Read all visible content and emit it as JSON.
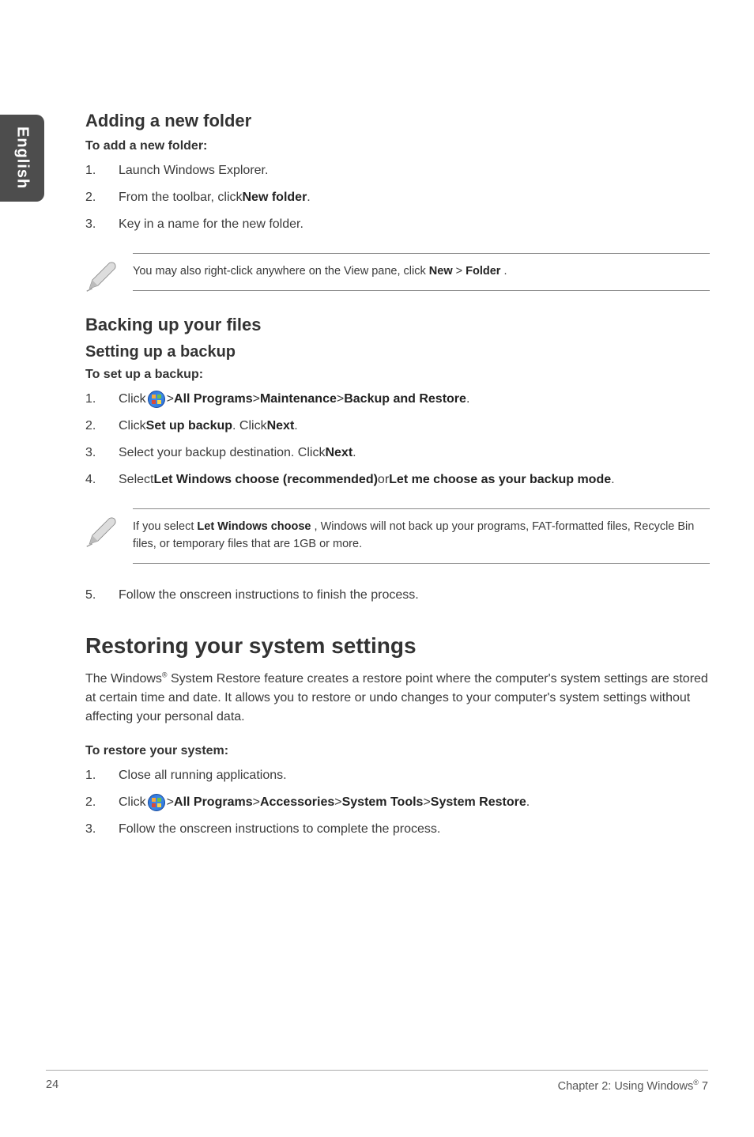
{
  "sideTab": "English",
  "sections": {
    "addFolder": {
      "heading": "Adding a new folder",
      "sub": "To add a new folder:",
      "steps": {
        "n1": "1.",
        "t1": "Launch Windows Explorer.",
        "n2": "2.",
        "t2a": "From the toolbar, click ",
        "t2b": "New folder",
        "t2c": ".",
        "n3": "3.",
        "t3": "Key in a name for the new folder."
      },
      "noteA": "You may also right-click anywhere on the View pane, click ",
      "noteB": "New",
      "noteC": " > ",
      "noteD": "Folder",
      "noteE": "."
    },
    "backup": {
      "heading": "Backing up your files",
      "subA": "Setting up a backup",
      "subB": "To set up a backup:",
      "steps": {
        "n1": "1.",
        "t1a": "Click ",
        "t1b": " > ",
        "t1c": "All Programs",
        "t1d": " > ",
        "t1e": "Maintenance",
        "t1f": " > ",
        "t1g": "Backup and Restore",
        "t1h": ".",
        "n2": "2.",
        "t2a": "Click ",
        "t2b": "Set up backup",
        "t2c": ". Click ",
        "t2d": "Next",
        "t2e": ".",
        "n3": "3.",
        "t3a": "Select your backup destination. Click ",
        "t3b": "Next",
        "t3c": ".",
        "n4": "4.",
        "t4a": "Select ",
        "t4b": "Let Windows choose (recommended)",
        "t4c": " or ",
        "t4d": "Let me choose as your backup mode",
        "t4e": "."
      },
      "noteA": "If you select ",
      "noteB": "Let Windows choose",
      "noteC": ", Windows will not back up your programs, FAT-formatted files, Recycle Bin files, or temporary files that are 1GB or more.",
      "step5n": "5.",
      "step5t": "Follow the onscreen instructions to finish the process."
    },
    "restore": {
      "heading": "Restoring your system settings",
      "paraA": "The Windows",
      "paraSup": "®",
      "paraB": " System Restore feature creates a restore point where the computer's system settings are stored at certain time and date. It allows you to restore or undo changes to your computer's system settings without affecting your personal data.",
      "sub": "To restore your system:",
      "steps": {
        "n1": "1.",
        "t1": "Close all running applications.",
        "n2": "2.",
        "t2a": "Click ",
        "t2b": " > ",
        "t2c": "All Programs",
        "t2d": " > ",
        "t2e": "Accessories",
        "t2f": " > ",
        "t2g": "System Tools",
        "t2h": " > ",
        "t2i": "System Restore",
        "t2j": ".",
        "n3": "3.",
        "t3": "Follow the onscreen instructions to complete the process."
      }
    }
  },
  "footer": {
    "page": "24",
    "chapterA": "Chapter 2: Using Windows",
    "chapterSup": "®",
    "chapterB": " 7"
  }
}
